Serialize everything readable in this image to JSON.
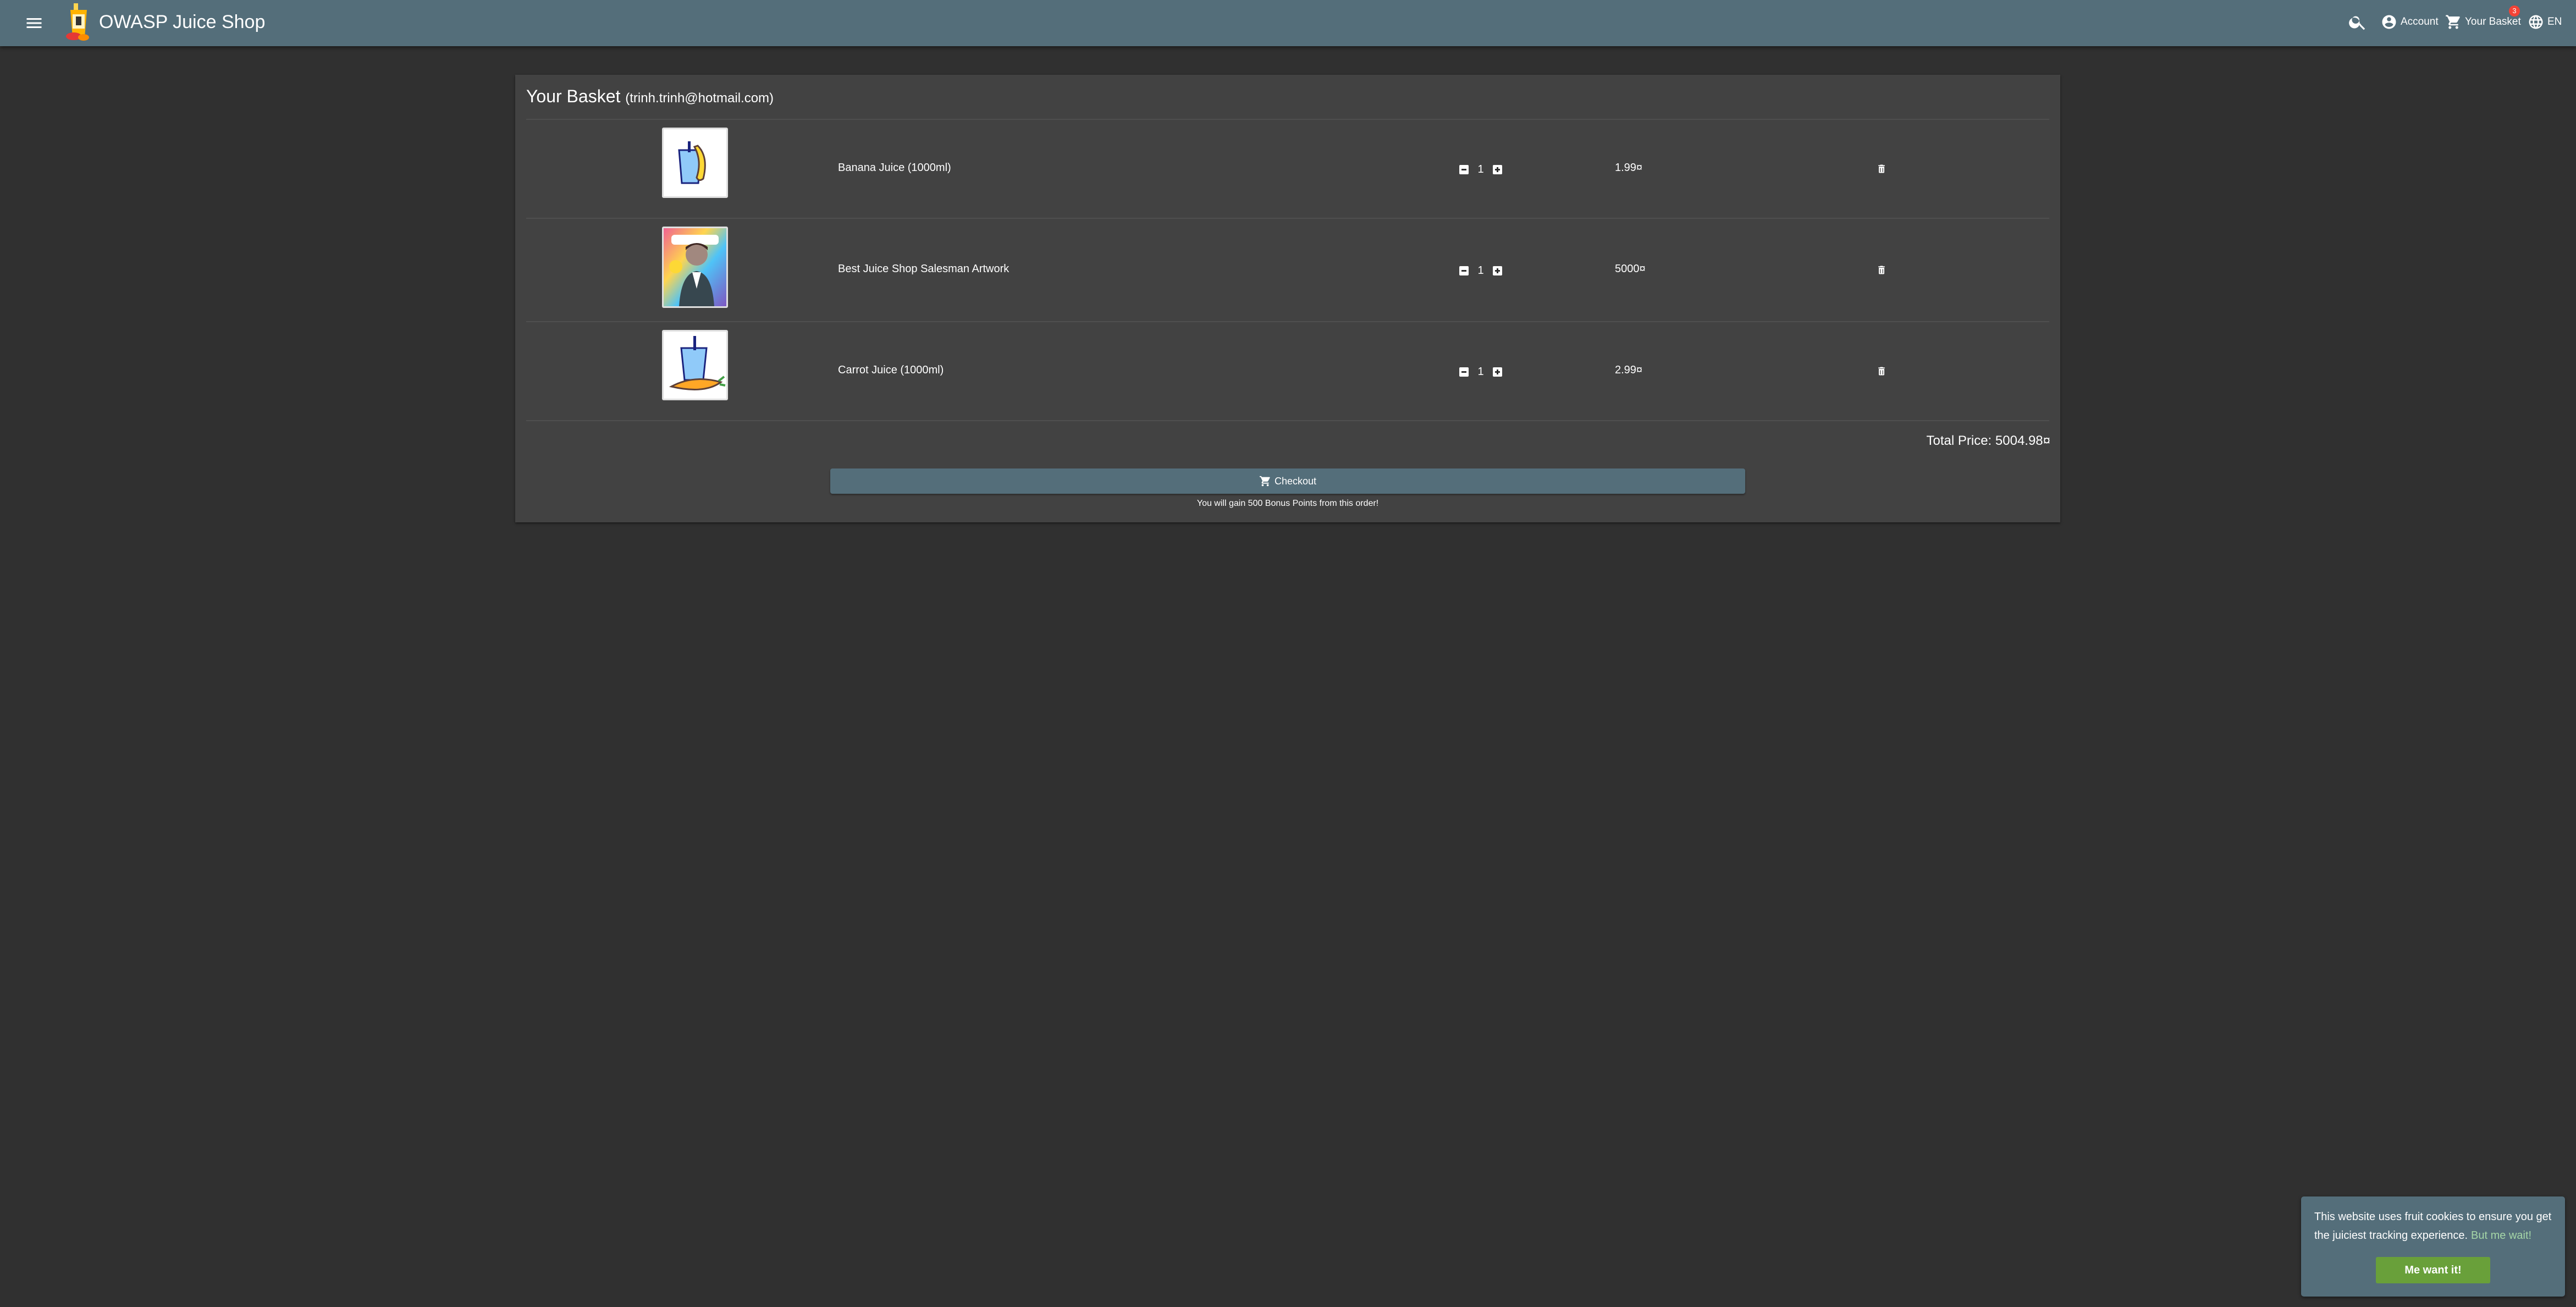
{
  "app": {
    "title": "OWASP Juice Shop"
  },
  "toolbar": {
    "account_label": "Account",
    "basket_label": "Your Basket",
    "basket_count": "3",
    "language_label": "EN"
  },
  "basket": {
    "heading": "Your Basket",
    "user": "(trinh.trinh@hotmail.com)",
    "items": [
      {
        "name": "Banana Juice (1000ml)",
        "quantity": "1",
        "price": "1.99¤"
      },
      {
        "name": "Best Juice Shop Salesman Artwork",
        "quantity": "1",
        "price": "5000¤"
      },
      {
        "name": "Carrot Juice (1000ml)",
        "quantity": "1",
        "price": "2.99¤"
      }
    ],
    "total_label": "Total Price: 5004.98¤",
    "checkout_label": "Checkout",
    "bonus_text": "You will gain 500 Bonus Points from this order!"
  },
  "cookie": {
    "message": "This website uses fruit cookies to ensure you get the juiciest tracking experience.",
    "link_label": "But me wait!",
    "button_label": "Me want it!"
  },
  "colors": {
    "toolbar": "#546e7a",
    "background": "#303030",
    "card": "#424242",
    "accent_green": "#69a03a",
    "badge_red": "#f44336"
  }
}
